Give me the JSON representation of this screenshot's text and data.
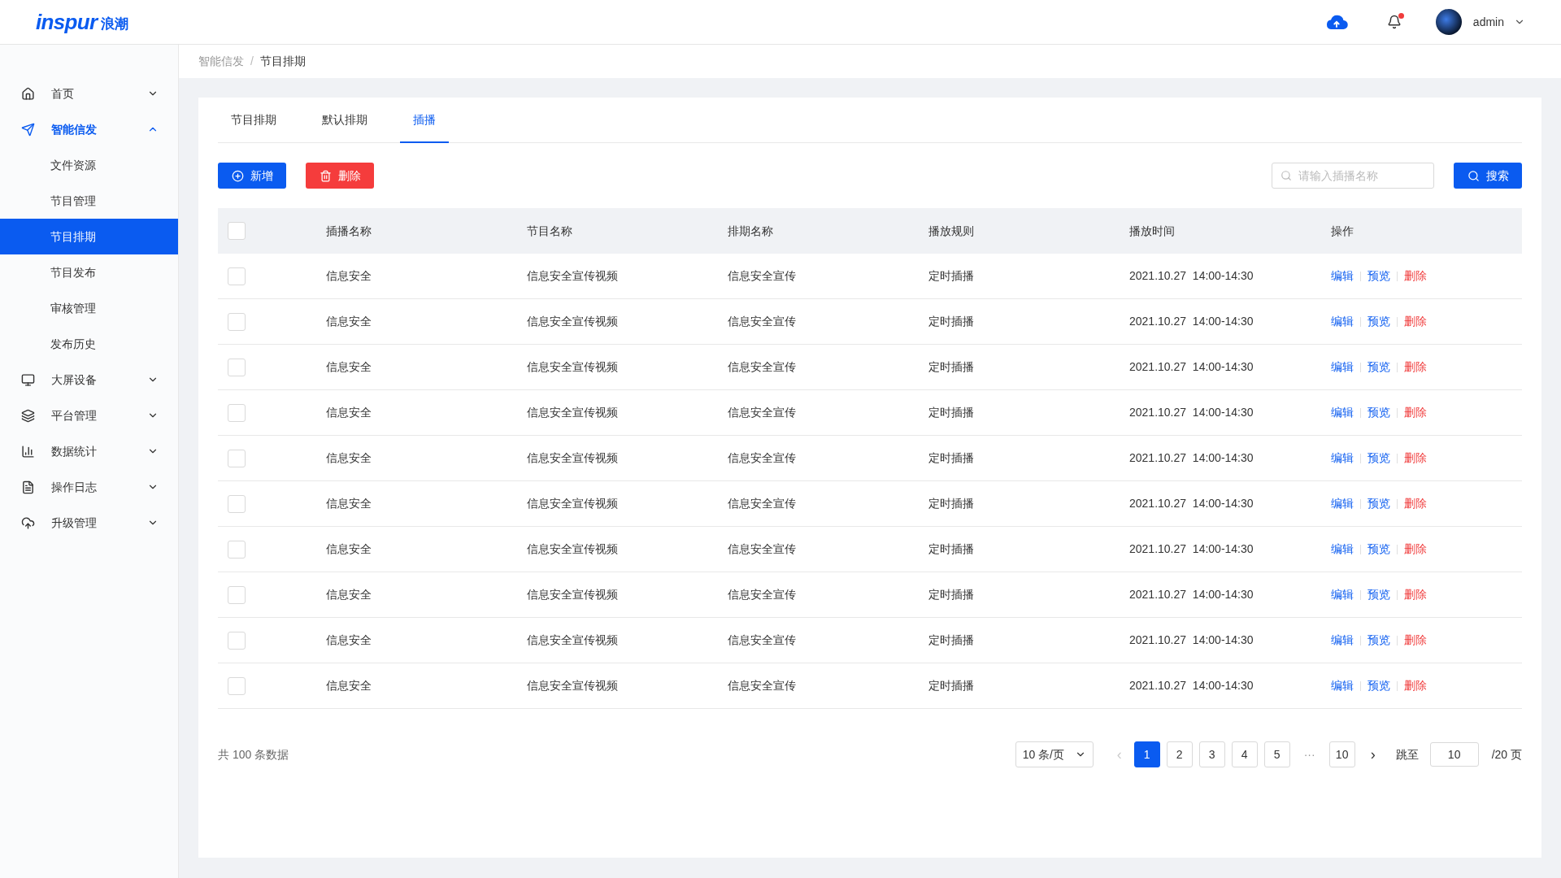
{
  "header": {
    "logo_latin": "inspur",
    "logo_cjk": "浪潮",
    "notification_badge": true,
    "user": "admin"
  },
  "sidebar": {
    "items": [
      {
        "label": "首页",
        "expanded": false,
        "selected": false
      },
      {
        "label": "智能信发",
        "expanded": true,
        "selected": true,
        "children": [
          {
            "label": "文件资源",
            "selected": false
          },
          {
            "label": "节目管理",
            "selected": false
          },
          {
            "label": "节目排期",
            "selected": true
          },
          {
            "label": "节目发布",
            "selected": false
          },
          {
            "label": "审核管理",
            "selected": false
          },
          {
            "label": "发布历史",
            "selected": false
          }
        ]
      },
      {
        "label": "大屏设备",
        "expanded": false,
        "selected": false
      },
      {
        "label": "平台管理",
        "expanded": false,
        "selected": false
      },
      {
        "label": "数据统计",
        "expanded": false,
        "selected": false
      },
      {
        "label": "操作日志",
        "expanded": false,
        "selected": false
      },
      {
        "label": "升级管理",
        "expanded": false,
        "selected": false
      }
    ]
  },
  "breadcrumb": {
    "items": [
      "智能信发",
      "节目排期"
    ],
    "separator": "/"
  },
  "tabs": [
    {
      "label": "节目排期",
      "selected": false
    },
    {
      "label": "默认排期",
      "selected": false
    },
    {
      "label": "插播",
      "selected": true
    }
  ],
  "toolbar": {
    "add_button": "新增",
    "delete_button": "删除",
    "search": {
      "placeholder": "请输入插播名称"
    },
    "search_button": "搜索"
  },
  "table": {
    "header_checked": false,
    "columns": [
      "插播名称",
      "节目名称",
      "排期名称",
      "播放规则",
      "播放时间",
      "操作"
    ],
    "rows": [
      {
        "checked": false,
        "cells": [
          "信息安全",
          "信息安全宣传视频",
          "信息安全宣传",
          "定时插播",
          "2021.10.27  14:00-14:30"
        ],
        "actions": [
          {
            "label": "编辑",
            "kind": "edit"
          },
          {
            "label": "预览",
            "kind": "preview"
          },
          {
            "label": "删除",
            "kind": "delete"
          }
        ]
      },
      {
        "checked": false,
        "cells": [
          "信息安全",
          "信息安全宣传视频",
          "信息安全宣传",
          "定时插播",
          "2021.10.27  14:00-14:30"
        ],
        "actions": [
          {
            "label": "编辑",
            "kind": "edit"
          },
          {
            "label": "预览",
            "kind": "preview"
          },
          {
            "label": "删除",
            "kind": "delete"
          }
        ]
      },
      {
        "checked": false,
        "cells": [
          "信息安全",
          "信息安全宣传视频",
          "信息安全宣传",
          "定时插播",
          "2021.10.27  14:00-14:30"
        ],
        "actions": [
          {
            "label": "编辑",
            "kind": "edit"
          },
          {
            "label": "预览",
            "kind": "preview"
          },
          {
            "label": "删除",
            "kind": "delete"
          }
        ]
      },
      {
        "checked": false,
        "cells": [
          "信息安全",
          "信息安全宣传视频",
          "信息安全宣传",
          "定时插播",
          "2021.10.27  14:00-14:30"
        ],
        "actions": [
          {
            "label": "编辑",
            "kind": "edit"
          },
          {
            "label": "预览",
            "kind": "preview"
          },
          {
            "label": "删除",
            "kind": "delete"
          }
        ]
      },
      {
        "checked": false,
        "cells": [
          "信息安全",
          "信息安全宣传视频",
          "信息安全宣传",
          "定时插播",
          "2021.10.27  14:00-14:30"
        ],
        "actions": [
          {
            "label": "编辑",
            "kind": "edit"
          },
          {
            "label": "预览",
            "kind": "preview"
          },
          {
            "label": "删除",
            "kind": "delete"
          }
        ]
      },
      {
        "checked": false,
        "cells": [
          "信息安全",
          "信息安全宣传视频",
          "信息安全宣传",
          "定时插播",
          "2021.10.27  14:00-14:30"
        ],
        "actions": [
          {
            "label": "编辑",
            "kind": "edit"
          },
          {
            "label": "预览",
            "kind": "preview"
          },
          {
            "label": "删除",
            "kind": "delete"
          }
        ]
      },
      {
        "checked": false,
        "cells": [
          "信息安全",
          "信息安全宣传视频",
          "信息安全宣传",
          "定时插播",
          "2021.10.27  14:00-14:30"
        ],
        "actions": [
          {
            "label": "编辑",
            "kind": "edit"
          },
          {
            "label": "预览",
            "kind": "preview"
          },
          {
            "label": "删除",
            "kind": "delete"
          }
        ]
      },
      {
        "checked": false,
        "cells": [
          "信息安全",
          "信息安全宣传视频",
          "信息安全宣传",
          "定时插播",
          "2021.10.27  14:00-14:30"
        ],
        "actions": [
          {
            "label": "编辑",
            "kind": "edit"
          },
          {
            "label": "预览",
            "kind": "preview"
          },
          {
            "label": "删除",
            "kind": "delete"
          }
        ]
      },
      {
        "checked": false,
        "cells": [
          "信息安全",
          "信息安全宣传视频",
          "信息安全宣传",
          "定时插播",
          "2021.10.27  14:00-14:30"
        ],
        "actions": [
          {
            "label": "编辑",
            "kind": "edit"
          },
          {
            "label": "预览",
            "kind": "preview"
          },
          {
            "label": "删除",
            "kind": "delete"
          }
        ]
      },
      {
        "checked": false,
        "cells": [
          "信息安全",
          "信息安全宣传视频",
          "信息安全宣传",
          "定时插播",
          "2021.10.27  14:00-14:30"
        ],
        "actions": [
          {
            "label": "编辑",
            "kind": "edit"
          },
          {
            "label": "预览",
            "kind": "preview"
          },
          {
            "label": "删除",
            "kind": "delete"
          }
        ]
      }
    ]
  },
  "pagination": {
    "total": "共 100 条数据",
    "page_size": "10 条/页",
    "prev": "‹",
    "pages": [
      {
        "label": "1",
        "selected": true
      },
      {
        "label": "2",
        "selected": false
      },
      {
        "label": "3",
        "selected": false
      },
      {
        "label": "4",
        "selected": false
      },
      {
        "label": "5",
        "selected": false
      },
      {
        "label": "···",
        "kind": "ellipsis"
      },
      {
        "label": "10",
        "selected": false
      }
    ],
    "next": "›",
    "jump_label": "跳至",
    "jump_value": "10",
    "page_total": "/20 页"
  }
}
